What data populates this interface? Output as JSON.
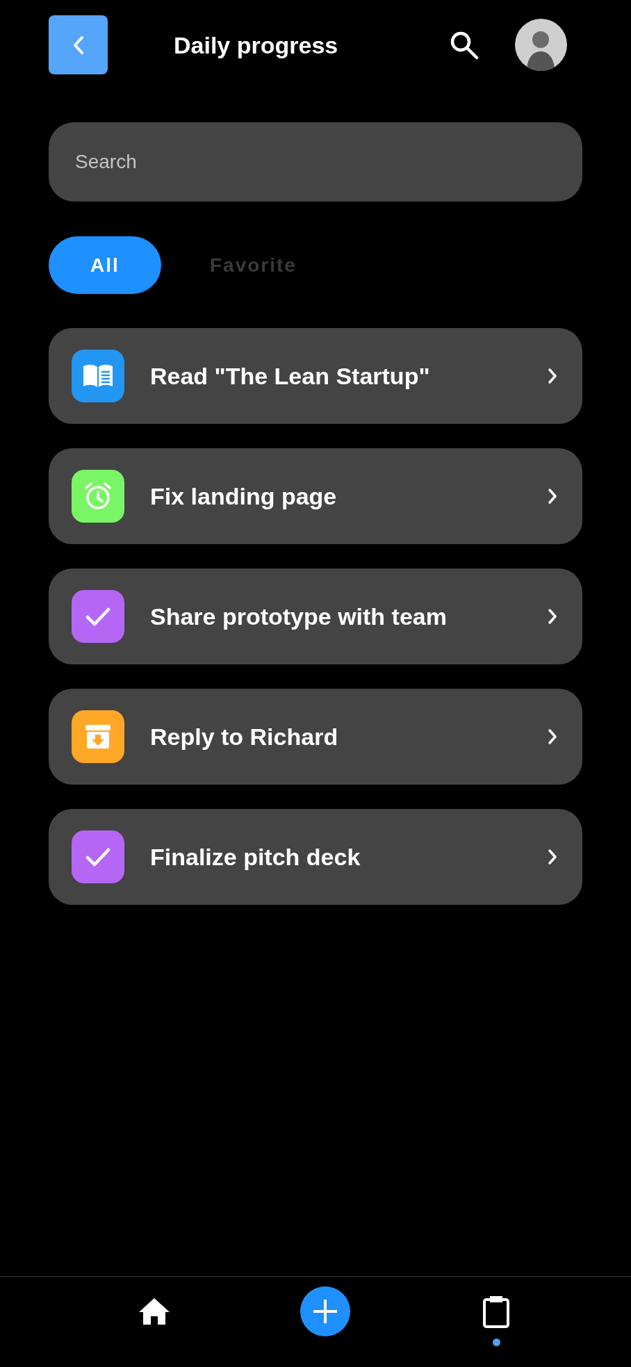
{
  "header": {
    "title": "Daily progress"
  },
  "search": {
    "placeholder": "Search"
  },
  "tabs": [
    {
      "label": "All",
      "selected": true
    },
    {
      "label": "Favorite",
      "selected": false
    }
  ],
  "tasks": [
    {
      "title": "Read \"The Lean Startup\"",
      "kind": "book",
      "color": "#2196f3"
    },
    {
      "title": "Fix landing page",
      "kind": "alarm",
      "color": "#7af565"
    },
    {
      "title": "Share prototype with team",
      "kind": "check",
      "color": "#b566f5"
    },
    {
      "title": "Reply to Richard",
      "kind": "archive",
      "color": "#ffa726"
    },
    {
      "title": "Finalize pitch deck",
      "kind": "check",
      "color": "#b566f5"
    }
  ],
  "nav": [
    {
      "kind": "home",
      "selected": false
    },
    {
      "kind": "add",
      "selected": false
    },
    {
      "kind": "clipboard",
      "selected": true
    }
  ]
}
